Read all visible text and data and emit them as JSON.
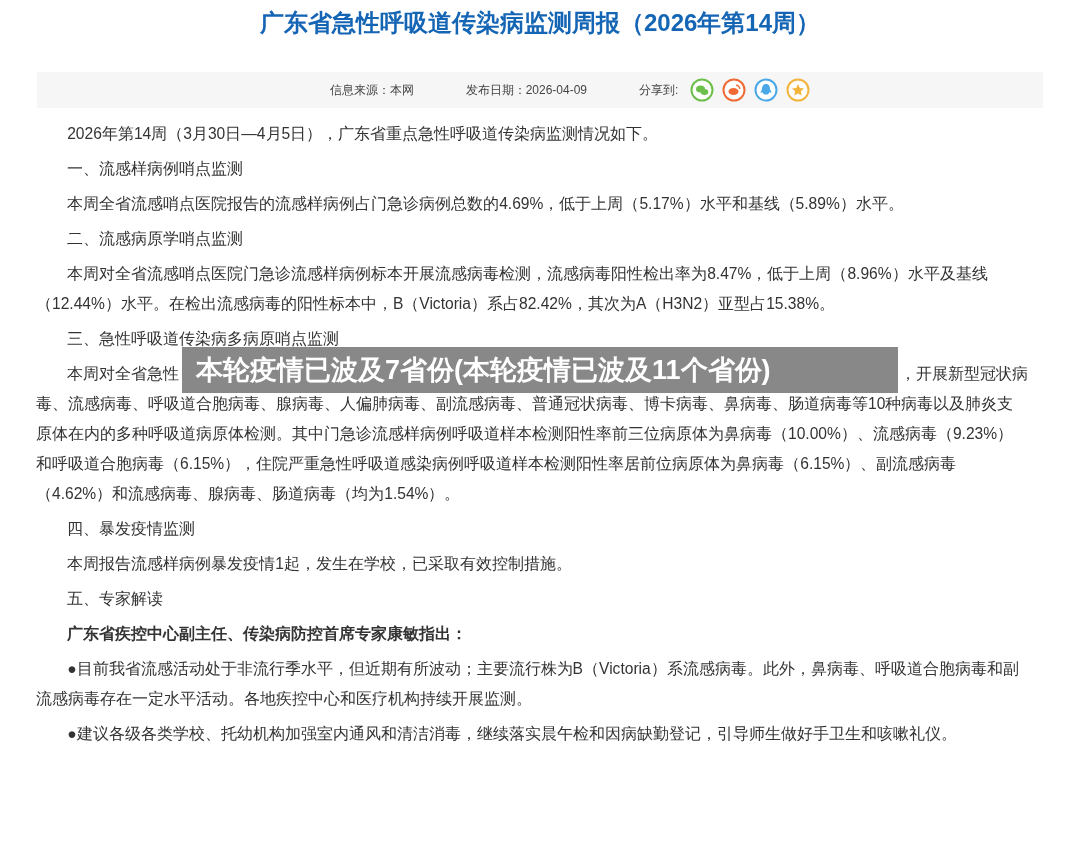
{
  "title": "广东省急性呼吸道传染病监测周报（2026年第14周）",
  "meta": {
    "source": "信息来源：本网",
    "date": "发布日期：2026-04-09",
    "share_label": "分享到:",
    "share_icons": [
      {
        "kind": "wechat",
        "color": "#6cbf4a"
      },
      {
        "kind": "weibo",
        "color": "#f06a35"
      },
      {
        "kind": "qq",
        "color": "#4aa8e8"
      },
      {
        "kind": "star",
        "color": "#f3b43c"
      }
    ]
  },
  "blocks": [
    {
      "kind": "para",
      "text": "2026年第14周（3月30日—4月5日），广东省重点急性呼吸道传染病监测情况如下。"
    },
    {
      "kind": "heading",
      "text": "一、流感样病例哨点监测"
    },
    {
      "kind": "para",
      "text": "本周全省流感哨点医院报告的流感样病例占门急诊病例总数的4.69%，低于上周（5.17%）水平和基线（5.89%）水平。"
    },
    {
      "kind": "heading",
      "text": "二、流感病原学哨点监测"
    },
    {
      "kind": "para",
      "text": "本周对全省流感哨点医院门急诊流感样病例标本开展流感病毒检测，流感病毒阳性检出率为8.47%，低于上周（8.96%）水平及基线（12.44%）水平。在检出流感病毒的阳性标本中，B（Victoria）系占82.42%，其次为A（H3N2）亚型占15.38%。"
    },
    {
      "kind": "heading",
      "text": "三、急性呼吸道传染病多病原哨点监测"
    },
    {
      "kind": "covered",
      "lead": "本周对全省急性",
      "tail": "，开展新型冠状病",
      "rest": "毒、流感病毒、呼吸道合胞病毒、腺病毒、人偏肺病毒、副流感病毒、普通冠状病毒、博卡病毒、鼻病毒、肠道病毒等10种病毒以及肺炎支原体在内的多种呼吸道病原体检测。其中门急诊流感样病例呼吸道样本检测阳性率前三位病原体为鼻病毒（10.00%）、流感病毒（9.23%）和呼吸道合胞病毒（6.15%），住院严重急性呼吸道感染病例呼吸道样本检测阳性率居前位病原体为鼻病毒（6.15%）、副流感病毒（4.62%）和流感病毒、腺病毒、肠道病毒（均为1.54%）。",
      "banner": "本轮疫情已波及7省份(本轮疫情已波及11个省份)"
    },
    {
      "kind": "heading",
      "text": "四、暴发疫情监测"
    },
    {
      "kind": "para",
      "text": "本周报告流感样病例暴发疫情1起，发生在学校，已采取有效控制措施。"
    },
    {
      "kind": "heading",
      "text": "五、专家解读"
    },
    {
      "kind": "bold",
      "text": "广东省疾控中心副主任、传染病防控首席专家康敏指出："
    },
    {
      "kind": "para",
      "text": "●目前我省流感活动处于非流行季水平，但近期有所波动；主要流行株为B（Victoria）系流感病毒。此外，鼻病毒、呼吸道合胞病毒和副流感病毒存在一定水平活动。各地疾控中心和医疗机构持续开展监测。"
    },
    {
      "kind": "para",
      "text": "●建议各级各类学校、托幼机构加强室内通风和清洁消毒，继续落实晨午检和因病缺勤登记，引导师生做好手卫生和咳嗽礼仪。"
    }
  ]
}
